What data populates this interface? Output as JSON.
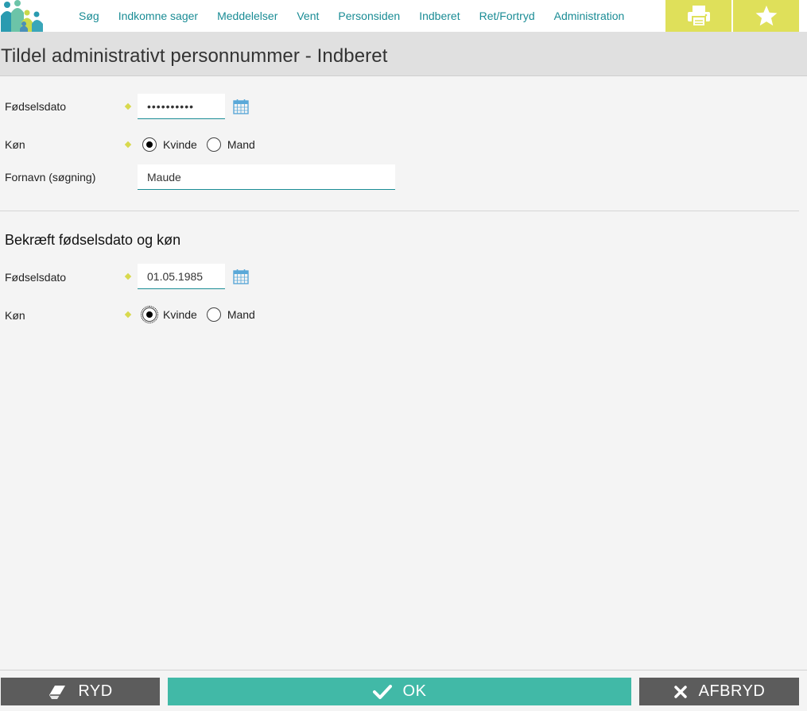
{
  "nav": {
    "items": [
      "Søg",
      "Indkomne sager",
      "Meddelelser",
      "Vent",
      "Personsiden",
      "Indberet",
      "Ret/Fortryd",
      "Administration"
    ]
  },
  "title": "Tildel administrativt personnummer - Indberet",
  "form1": {
    "birthdate_label": "Fødselsdato",
    "birthdate_value": "••••••••••",
    "gender_label": "Køn",
    "gender_options": [
      "Kvinde",
      "Mand"
    ],
    "gender_selected": "Kvinde",
    "firstname_label": "Fornavn (søgning)",
    "firstname_value": "Maude"
  },
  "confirm": {
    "heading": "Bekræft fødselsdato og køn",
    "birthdate_label": "Fødselsdato",
    "birthdate_value": "01.05.1985",
    "gender_label": "Køn",
    "gender_options": [
      "Kvinde",
      "Mand"
    ],
    "gender_selected": "Kvinde"
  },
  "footer": {
    "clear_label": "RYD",
    "ok_label": "OK",
    "cancel_label": "AFBRYD"
  },
  "icons": {
    "print": "printer-icon",
    "favorite": "star-icon",
    "calendar": "calendar-icon",
    "clear": "eraser-icon",
    "ok": "check-icon",
    "cancel": "close-icon"
  },
  "colors": {
    "accent": "#1a8c95",
    "highlight": "#dfe05a",
    "ok": "#41b9a7",
    "dark_button": "#5c5c5c"
  }
}
